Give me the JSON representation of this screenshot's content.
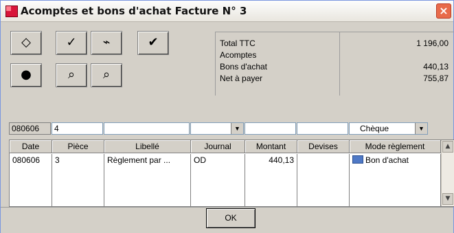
{
  "window": {
    "title": "Acomptes et bons d'achat Facture N° 3"
  },
  "toolbar": {
    "buttons": [
      {
        "name": "edit-tool-1"
      },
      {
        "name": "edit-tool-2"
      },
      {
        "name": "edit-tool-3"
      },
      {
        "name": "edit-tool-4"
      },
      {
        "name": "tool-5"
      },
      {
        "name": "tool-6"
      },
      {
        "name": "tool-7"
      }
    ]
  },
  "summary": {
    "total_ttc_label": "Total TTC",
    "total_ttc_value": "1 196,00",
    "acomptes_label": "Acomptes",
    "acomptes_value": "",
    "bons_achat_label": "Bons d'achat",
    "bons_achat_value": "440,13",
    "net_label": "Net à payer",
    "net_value": "755,87"
  },
  "input_row": {
    "date": "080606",
    "piece": "4",
    "libelle": "",
    "journal": "",
    "montant": "",
    "devises": "",
    "mode": "Chèque"
  },
  "table": {
    "headers": [
      "Date",
      "Pièce",
      "Libellé",
      "Journal",
      "Montant",
      "Devises",
      "Mode règlement"
    ],
    "rows": [
      {
        "date": "080606",
        "piece": "3",
        "libelle": "Règlement par ...",
        "journal": "OD",
        "montant": "440,13",
        "devises": "",
        "mode": "Bon d'achat"
      }
    ]
  },
  "footer": {
    "ok_label": "OK"
  }
}
